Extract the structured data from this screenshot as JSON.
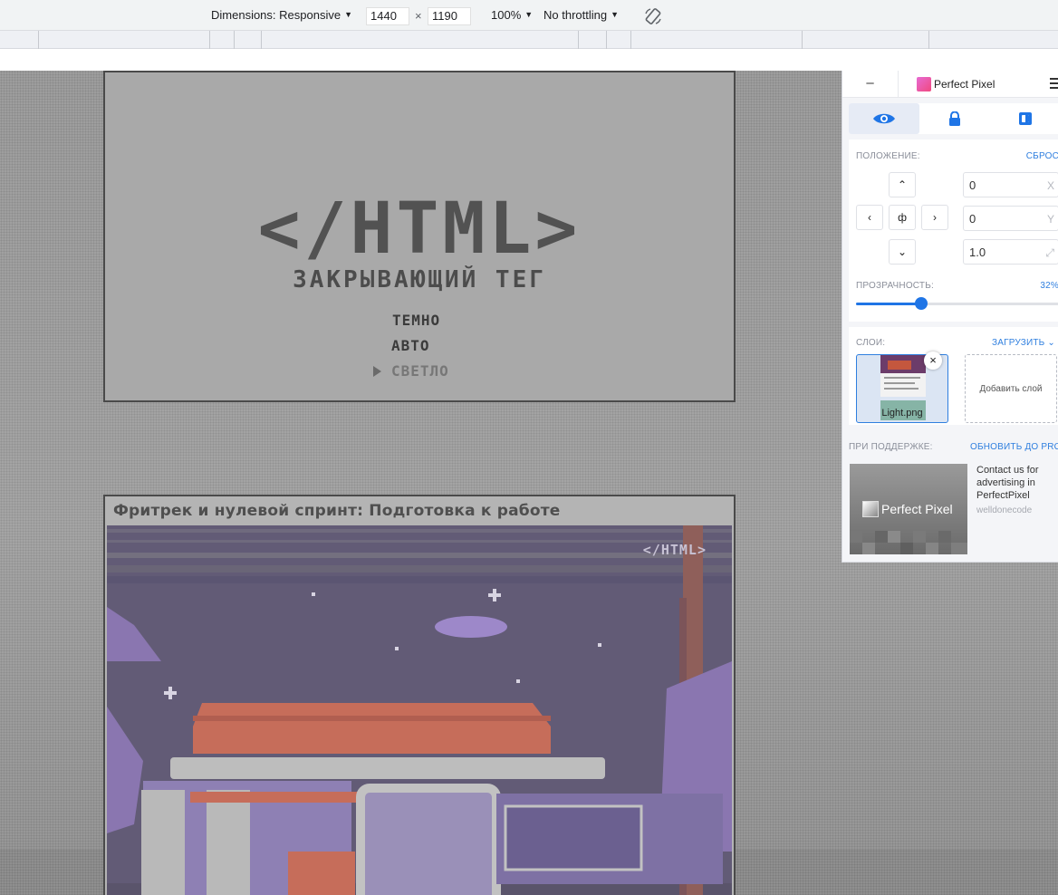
{
  "devtools": {
    "dimensions_label": "Dimensions: Responsive",
    "width_value": "1440",
    "height_value": "1190",
    "times": "×",
    "zoom": "100%",
    "throttling": "No throttling"
  },
  "page": {
    "hero": {
      "title": "</HTML>",
      "subtitle": "ЗАКРЫВАЮЩИЙ ТЕГ",
      "options": [
        "ТЕМНО",
        "АВТО",
        "СВЕТЛО"
      ],
      "selected_option": "СВЕТЛО"
    },
    "article": {
      "title": "Фритрек и нулевой спринт: Подготовка к работе",
      "image_logo": "</HTML>"
    }
  },
  "perfect_pixel": {
    "minimize": "–",
    "brand": "Perfect Pixel",
    "tabs": [
      "eye-icon",
      "lock-icon",
      "invert-icon"
    ],
    "position_label": "ПОЛОЖЕНИЕ:",
    "reset_label": "СБРОС",
    "center_button": "ф",
    "x_value": "0",
    "x_suffix": "X",
    "y_value": "0",
    "y_suffix": "Y",
    "scale_value": "1.0",
    "opacity_label": "ПРОЗРАЧНОСТЬ:",
    "opacity_value": "32%",
    "opacity_level": 32,
    "layers_label": "СЛОИ:",
    "upload_label": "ЗАГРУЗИТЬ",
    "layer_name": "Light.png",
    "add_layer": "Добавить слой",
    "support_label": "ПРИ ПОДДЕРЖКЕ:",
    "upgrade_label": "ОБНОВИТЬ ДО PRO",
    "ad_logo": "Perfect Pixel",
    "ad_text": "Contact us for advertising in PerfectPixel",
    "ad_source": "welldonecode"
  },
  "colors": {
    "accent": "#1f75e6",
    "link": "#2f7fdf",
    "page_bg": "#9d9d9d",
    "hero_bg": "#a9a9a9"
  }
}
